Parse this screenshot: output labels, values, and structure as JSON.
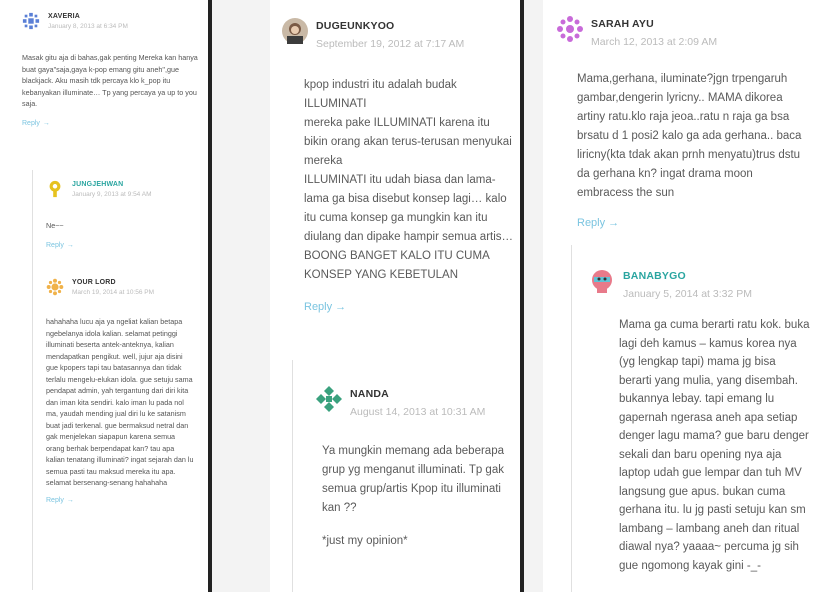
{
  "accent_color": "#7ac4e0",
  "reply_icon": "arrow-right-icon",
  "column1": {
    "xaveria": {
      "author": "XAVERIA",
      "date": "January 8, 2013 at 6:34 PM",
      "text": "Masak gitu aja di bahas,gak penting Mereka kan hanya buat gaya\"saja,gaya k-pop emang gitu aneh\",gue blackjack. Aku masih tdk percaya klo k_pop itu kebanyakan illuminate… Tp yang percaya ya up to you saja.",
      "reply": "Reply"
    },
    "jungjehwan": {
      "author": "JUNGJEHWAN",
      "date": "January 9, 2013 at 9:54 AM",
      "text": "Ne~~",
      "reply": "Reply"
    },
    "yourlord": {
      "author": "YOUR LORD",
      "date": "March 19, 2014 at 10:56 PM",
      "text": "hahahaha lucu aja ya ngeliat kalian betapa ngebelanya idola kalian. selamat petinggi illuminati beserta antek-anteknya, kalian mendapatkan pengikut. well, jujur aja disini gue kpopers tapi tau batasannya dan tidak terlalu mengelu-elukan idola. gue setuju sama pendapat admin, yah tergantung dari diri kita dan iman kita sendiri. kalo iman lu pada nol ma, yaudah mending jual diri lu ke satanism buat jadi terkenal. gue bermaksud netral dan gak menjelekan siapapun karena semua orang berhak berpendapat kan? tau apa kalian tenatang illuminati? ingat sejarah dan lu semua pasti tau maksud mereka itu apa. selamat bersenang-senang hahahaha",
      "reply": "Reply"
    }
  },
  "column2": {
    "dugeunkyoo": {
      "author": "DUGEUNKYOO",
      "date": "September 19, 2012 at 7:17 AM",
      "lines": [
        "kpop industri itu adalah budak ILLUMINATI",
        "mereka pake ILLUMINATI karena itu bikin orang akan terus-terusan menyukai mereka",
        "ILLUMINATI itu udah biasa dan lama-lama ga bisa disebut konsep lagi… kalo itu cuma konsep ga mungkin kan itu diulang dan dipake hampir semua artis…",
        "BOONG BANGET KALO ITU CUMA KONSEP YANG KEBETULAN"
      ],
      "reply": "Reply"
    },
    "nanda": {
      "author": "NANDA",
      "date": "August 14, 2013 at 10:31 AM",
      "lines": [
        "Ya mungkin memang ada beberapa grup yg menganut illuminati. Tp gak semua grup/artis Kpop itu illuminati kan ??",
        "*just my opinion*"
      ]
    }
  },
  "column3": {
    "sarahayu": {
      "author": "SARAH AYU",
      "date": "March 12, 2013 at 2:09 AM",
      "text": "Mama,gerhana, iluminate?jgn trpengaruh gambar,dengerin lyricny.. MAMA dikorea artiny ratu.klo raja jeoa..ratu n raja ga bsa brsatu d 1 posi2 kalo ga ada gerhana.. baca liricny(kta tdak akan prnh menyatu)trus dstu da gerhana kn? ingat drama moon embracess the sun",
      "reply": "Reply"
    },
    "banabygo": {
      "author": "BANABYGO",
      "date": "January 5, 2014 at 3:32 PM",
      "text": "Mama ga cuma berarti ratu kok. buka lagi deh kamus – kamus korea nya (yg lengkap tapi) mama jg bisa berarti yang mulia, yang disembah. bukannya lebay. tapi emang lu gapernah ngerasa aneh apa setiap denger lagu mama? gue baru denger sekali dan baru opening nya aja laptop udah gue lempar dan tuh MV langsung gue apus. bukan cuma gerhana itu. lu jg pasti setuju kan sm lambang – lambang aneh dan ritual diawal nya? yaaaa~ percuma jg sih gue ngomong kayak gini -_-"
    }
  }
}
